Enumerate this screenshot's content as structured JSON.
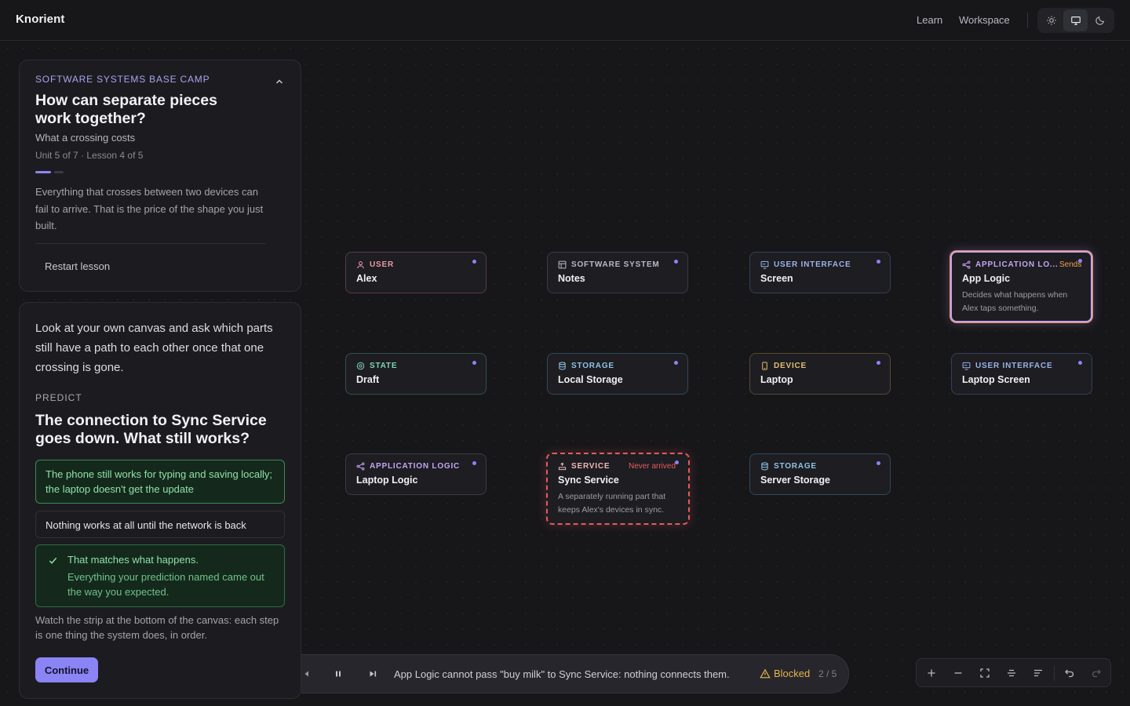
{
  "header": {
    "brand": "Knorient",
    "nav": [
      "Learn",
      "Workspace"
    ],
    "theme_options": [
      "light-theme-icon",
      "system-theme-icon",
      "dark-theme-icon"
    ],
    "active_theme": "system"
  },
  "lesson": {
    "kicker": "SOFTWARE SYSTEMS BASE CAMP",
    "title": "How can separate pieces work together?",
    "subtitle": "What a crossing costs",
    "meta": "Unit 5 of 7 · Lesson 4 of 5",
    "progress": {
      "current": 4,
      "total": 5
    },
    "description": "Everything that crosses between two devices can fail to arrive. That is the price of the shape you just built.",
    "restart_label": "Restart lesson"
  },
  "quiz": {
    "prompt": "Look at your own canvas and ask which parts still have a path to each other once that one crossing is gone.",
    "predict_label": "PREDICT",
    "question": "The connection to Sync Service goes down. What still works?",
    "options": [
      {
        "text": "The phone still works for typing and saving locally; the laptop doesn't get the update",
        "selected": true
      },
      {
        "text": "Nothing works at all until the network is back",
        "selected": false
      }
    ],
    "feedback_title": "That matches what happens.",
    "feedback_body": "Everything your prediction named came out the way you expected.",
    "watch_note": "Watch the strip at the bottom of the canvas: each step is one thing the system does, in order.",
    "continue_label": "Continue"
  },
  "colors": {
    "accent": "#8b84f5",
    "success": "#8fe0a7",
    "warning": "#e8b34a",
    "error": "#e85a5a",
    "sends": "#f0a050"
  },
  "nodes": {
    "alex": {
      "type": "USER",
      "label": "Alex",
      "icon": "user-icon"
    },
    "notes": {
      "type": "SOFTWARE SYSTEM",
      "label": "Notes",
      "icon": "system-icon"
    },
    "screen": {
      "type": "USER INTERFACE",
      "label": "Screen",
      "icon": "interface-icon"
    },
    "app_logic": {
      "type": "APPLICATION LO...",
      "label": "App Logic",
      "status": "Sends",
      "description": "Decides what happens when Alex taps something.",
      "icon": "share-icon"
    },
    "draft": {
      "type": "STATE",
      "label": "Draft",
      "icon": "state-icon"
    },
    "local_storage": {
      "type": "STORAGE",
      "label": "Local Storage",
      "icon": "database-icon"
    },
    "laptop": {
      "type": "DEVICE",
      "label": "Laptop",
      "icon": "device-icon"
    },
    "laptop_screen": {
      "type": "USER INTERFACE",
      "label": "Laptop Screen",
      "icon": "interface-icon"
    },
    "laptop_logic": {
      "type": "APPLICATION LOGIC",
      "label": "Laptop Logic",
      "icon": "share-icon"
    },
    "sync_service": {
      "type": "SERVICE",
      "label": "Sync Service",
      "status": "Never arrived",
      "description": "A separately running part that keeps Alex's devices in sync.",
      "icon": "service-icon"
    },
    "server_storage": {
      "type": "STORAGE",
      "label": "Server Storage",
      "icon": "database-icon"
    }
  },
  "playbar": {
    "message": "App Logic cannot pass \"buy milk\" to Sync Service: nothing connects them.",
    "status": "Blocked",
    "step": "2 / 5"
  }
}
